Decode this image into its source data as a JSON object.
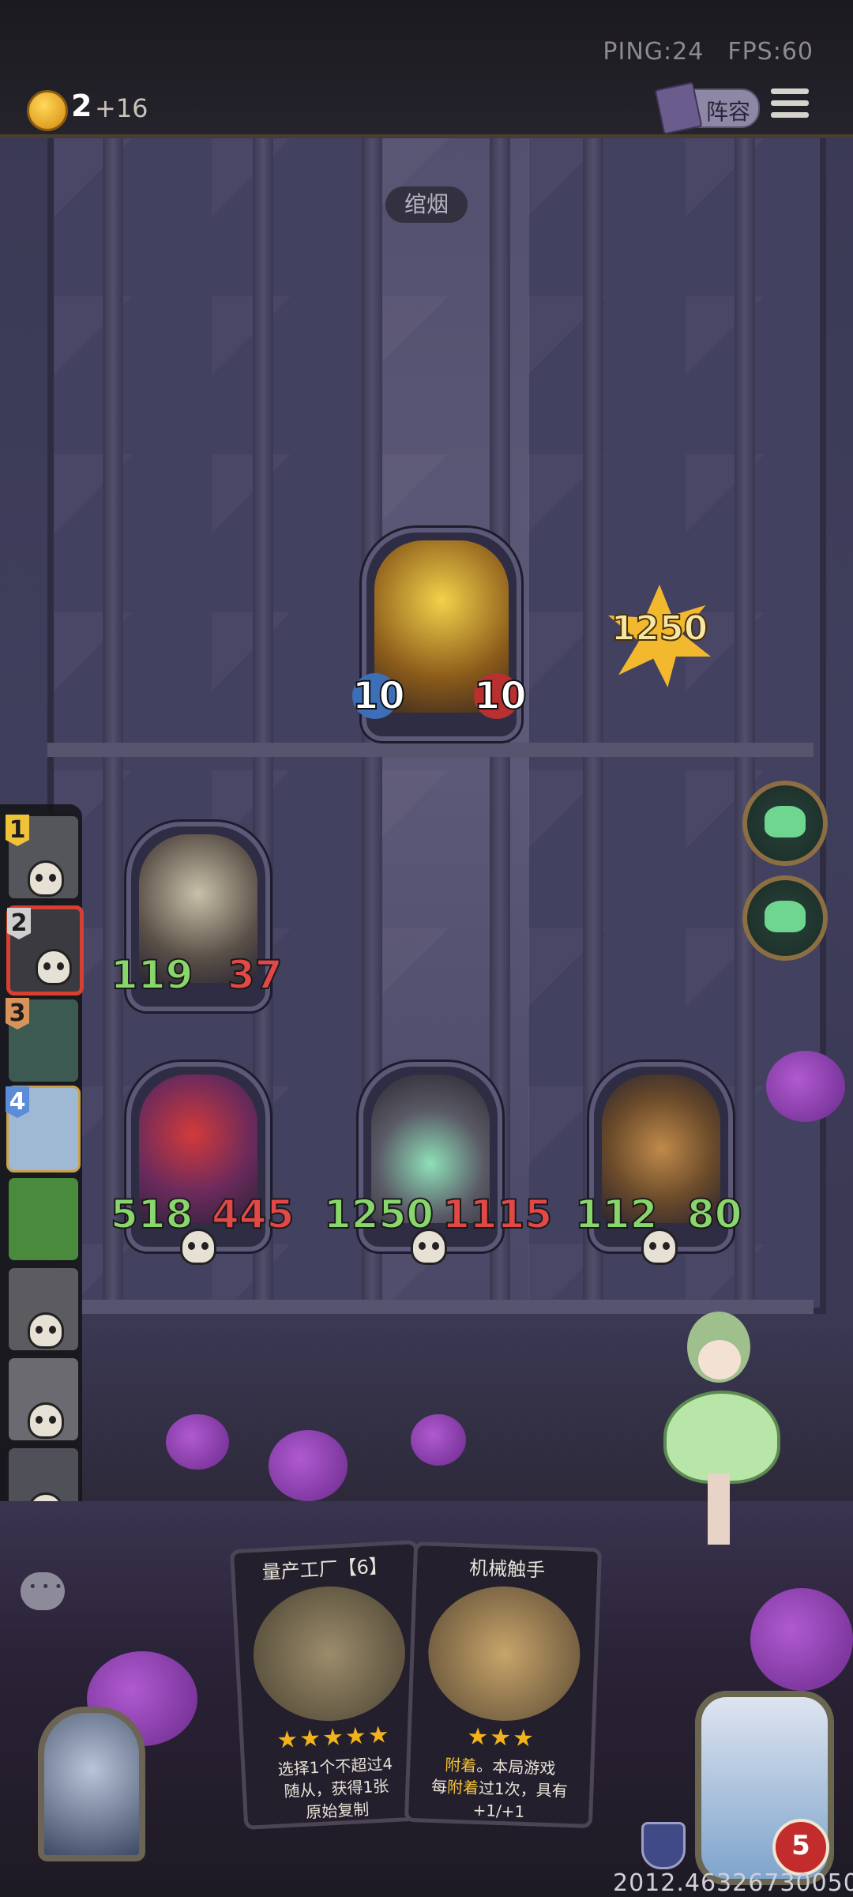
{
  "status": {
    "ping": "PING:24",
    "fps": "FPS:60"
  },
  "coins": {
    "value": "2",
    "income": "+16"
  },
  "header": {
    "lineup_label": "阵容"
  },
  "opponent": {
    "name": "绾烟"
  },
  "enemy_hero": {
    "attack": "10",
    "health": "10"
  },
  "damage_burst": "1250",
  "board": {
    "minions": [
      {
        "attack": "119",
        "health": "37"
      },
      {
        "attack": "518",
        "health": "445"
      },
      {
        "attack": "1250",
        "health": "1115"
      },
      {
        "attack": "112",
        "health": "80"
      }
    ]
  },
  "roster": {
    "ranks": [
      "1",
      "2",
      "3",
      "4"
    ]
  },
  "hand": {
    "cards": [
      {
        "title": "量产工厂【6】",
        "stars": "★★★★★",
        "desc_line1": "选择1个不超过4",
        "desc_line2": "随从，获得1张",
        "desc_line3": "原始复制"
      },
      {
        "title": "机械触手",
        "stars": "★★★",
        "desc_kw1": "附着",
        "desc_tail1": "。本局游戏",
        "desc_pre2": "每",
        "desc_kw2": "附着",
        "desc_tail2": "过1次，具有",
        "desc_line3": "+1/+1"
      }
    ]
  },
  "player": {
    "health": "5"
  },
  "seed": "2012.46326730050"
}
